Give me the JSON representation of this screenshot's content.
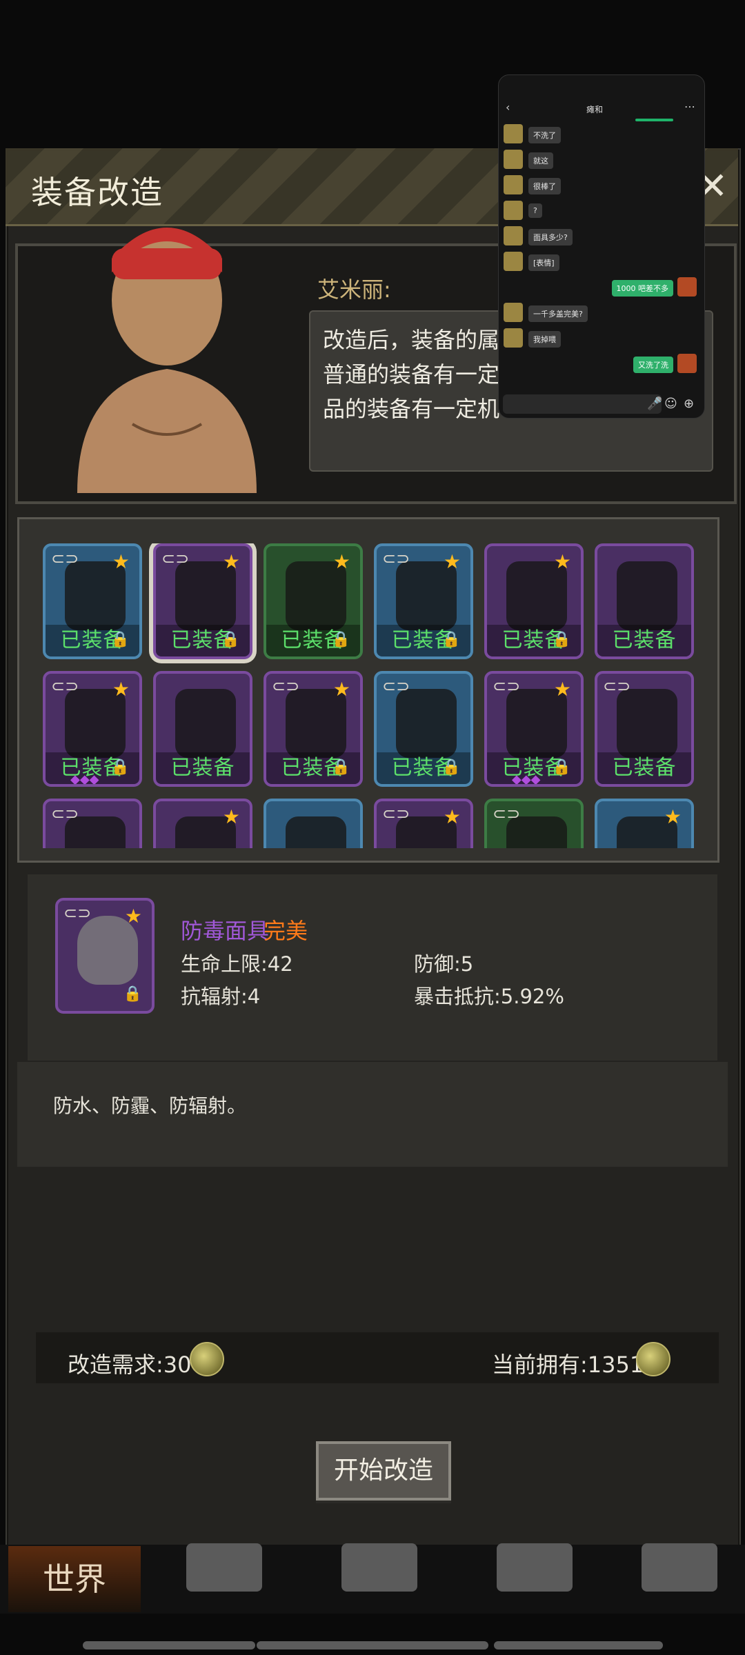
{
  "modal": {
    "title": "装备改造",
    "close_glyph": "✕"
  },
  "npc": {
    "name": "艾米丽:",
    "lines": [
      "改造后，装备的属性",
      "普通的装备有一定机",
      "品的装备有一定机率"
    ]
  },
  "grid": {
    "rows": [
      [
        {
          "tier": "blue",
          "star": true,
          "link": true,
          "equipped": "已装备",
          "lock": true,
          "gems": ""
        },
        {
          "tier": "purple",
          "star": true,
          "link": true,
          "equipped": "已装备",
          "lock": true,
          "gems": "",
          "selected": true
        },
        {
          "tier": "green",
          "star": true,
          "link": false,
          "equipped": "已装备",
          "lock": true,
          "gems": ""
        },
        {
          "tier": "blue",
          "star": true,
          "link": true,
          "equipped": "已装备",
          "lock": true,
          "gems": ""
        },
        {
          "tier": "purple",
          "star": true,
          "link": false,
          "equipped": "已装备",
          "lock": true,
          "gems": ""
        },
        {
          "tier": "purple",
          "star": false,
          "link": false,
          "equipped": "已装备",
          "lock": false,
          "gems": ""
        }
      ],
      [
        {
          "tier": "purple",
          "star": true,
          "link": true,
          "equipped": "已装备",
          "lock": true,
          "gems": "◆◆◆"
        },
        {
          "tier": "purple",
          "star": false,
          "link": false,
          "equipped": "已装备",
          "lock": false,
          "gems": ""
        },
        {
          "tier": "purple",
          "star": true,
          "link": true,
          "equipped": "已装备",
          "lock": true,
          "gems": ""
        },
        {
          "tier": "blue",
          "star": false,
          "link": true,
          "equipped": "已装备",
          "lock": true,
          "gems": ""
        },
        {
          "tier": "purple",
          "star": true,
          "link": true,
          "equipped": "已装备",
          "lock": true,
          "gems": "◆◆◆"
        },
        {
          "tier": "purple",
          "star": false,
          "link": true,
          "equipped": "已装备",
          "lock": false,
          "gems": ""
        }
      ],
      [
        {
          "tier": "purple",
          "star": false,
          "link": true,
          "equipped": "",
          "lock": false,
          "gems": ""
        },
        {
          "tier": "purple",
          "star": true,
          "link": false,
          "equipped": "",
          "lock": false,
          "gems": ""
        },
        {
          "tier": "blue",
          "star": false,
          "link": false,
          "equipped": "",
          "lock": false,
          "gems": ""
        },
        {
          "tier": "purple",
          "star": true,
          "link": true,
          "equipped": "",
          "lock": false,
          "gems": ""
        },
        {
          "tier": "green",
          "star": false,
          "link": true,
          "equipped": "",
          "lock": false,
          "gems": ""
        },
        {
          "tier": "blue",
          "star": true,
          "link": false,
          "equipped": "",
          "lock": false,
          "gems": ""
        }
      ]
    ]
  },
  "detail": {
    "name": "防毒面具",
    "quality": "完美",
    "stats": {
      "hp": "生命上限:42",
      "def": "防御:5",
      "rad": "抗辐射:4",
      "crit": "暴击抵抗:5.92%"
    },
    "description": "防水、防霾、防辐射。"
  },
  "cost": {
    "required_label": "改造需求:30",
    "owned_label": "当前拥有:13516"
  },
  "start_button": "开始改造",
  "nav": {
    "world": "世界"
  },
  "chat": {
    "title": "瘫和",
    "messages": [
      {
        "from": "them",
        "text": "不洗了"
      },
      {
        "from": "them",
        "text": "就这"
      },
      {
        "from": "them",
        "text": "很棒了"
      },
      {
        "from": "them",
        "text": "?"
      },
      {
        "from": "them",
        "text": "面具多少?"
      },
      {
        "from": "them",
        "text": "[表情]"
      },
      {
        "from": "me",
        "text": "1000 吧差不多"
      },
      {
        "from": "them",
        "text": "一千多盖完美?"
      },
      {
        "from": "them",
        "text": "我掉喂"
      },
      {
        "from": "me",
        "text": "又洗了洗"
      }
    ]
  }
}
